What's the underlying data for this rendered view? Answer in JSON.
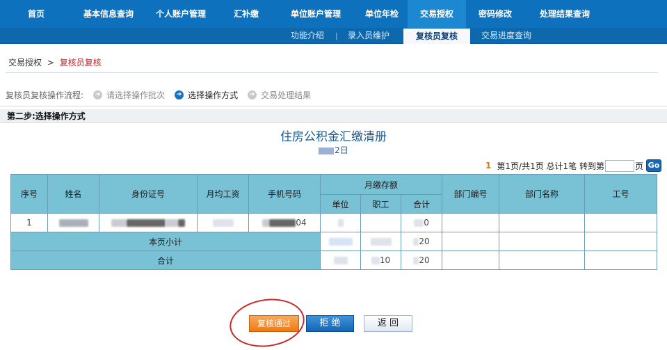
{
  "nav": {
    "items": [
      {
        "label": "首页"
      },
      {
        "label": "基本信息查询"
      },
      {
        "label": "个人账户管理"
      },
      {
        "label": "汇补缴"
      },
      {
        "label": "单位账户管理"
      },
      {
        "label": "单位年检"
      },
      {
        "label": "交易授权"
      },
      {
        "label": "密码修改"
      },
      {
        "label": "处理结果查询"
      }
    ],
    "active_index": 6,
    "sub_items": [
      {
        "label": "功能介绍"
      },
      {
        "label": "录入员维护"
      },
      {
        "label": "复核员复核"
      },
      {
        "label": "交易进度查询"
      }
    ],
    "sub_active_index": 2
  },
  "breadcrumb": {
    "parent": "交易授权",
    "separator": ">",
    "current": "复核员复核"
  },
  "flow": {
    "label": "复核员复核操作流程:",
    "steps": [
      {
        "label": "请选择操作批次"
      },
      {
        "label": "选择操作方式"
      },
      {
        "label": "交易处理结果"
      }
    ],
    "active_index": 1
  },
  "step_title": "第二步:选择操作方式",
  "report": {
    "title": "住房公积金汇缴清册",
    "date_suffix": "2日"
  },
  "pager": {
    "current_page": "1",
    "summary": "第1页/共1页 总计1笔 转到第",
    "page_input_value": "",
    "unit": "页",
    "go_label": "Go"
  },
  "table": {
    "headers": {
      "seq": "序号",
      "name": "姓名",
      "id_number": "身份证号",
      "avg_salary": "月均工资",
      "phone": "手机号码",
      "monthly_deposit": "月缴存额",
      "unit": "单位",
      "employee": "职工",
      "total": "合计",
      "dept_code": "部门编号",
      "dept_name": "部门名称",
      "job_number": "工号"
    },
    "rows": [
      {
        "seq": "1",
        "phone_suffix": "04",
        "total_suffix": "0"
      }
    ],
    "subtotal_label": "本页小计",
    "subtotal_total_suffix": "20",
    "grand_total_label": "合计",
    "grand_total_employee_suffix": "10",
    "grand_total_total_suffix": "20"
  },
  "buttons": {
    "approve": "复核通过",
    "reject": "拒 绝",
    "back": "返 回"
  },
  "colors": {
    "nav_bg": "#0d71bd",
    "header_cell": "#79c1d4",
    "approve_button": "#ef7a13",
    "reject_button": "#1565b4",
    "annotation_circle": "#c62a2a"
  }
}
